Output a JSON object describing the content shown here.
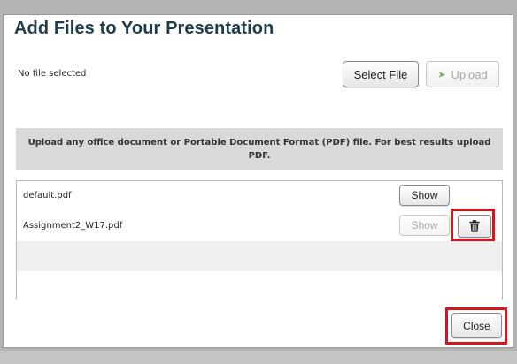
{
  "dialog": {
    "title": "Add Files to Your Presentation",
    "file_status": "No file selected",
    "select_file_label": "Select File",
    "upload_label": "Upload",
    "info_text": "Upload any office document or Portable Document Format (PDF) file.  For best results upload PDF.",
    "close_label": "Close"
  },
  "files": [
    {
      "name": "default.pdf",
      "show_label": "Show"
    },
    {
      "name": "Assignment2_W17.pdf",
      "show_label": "Show"
    }
  ],
  "colors": {
    "highlight": "#d6141f",
    "title": "#1f3d4a",
    "upload_icon": "#5a9a3c"
  }
}
